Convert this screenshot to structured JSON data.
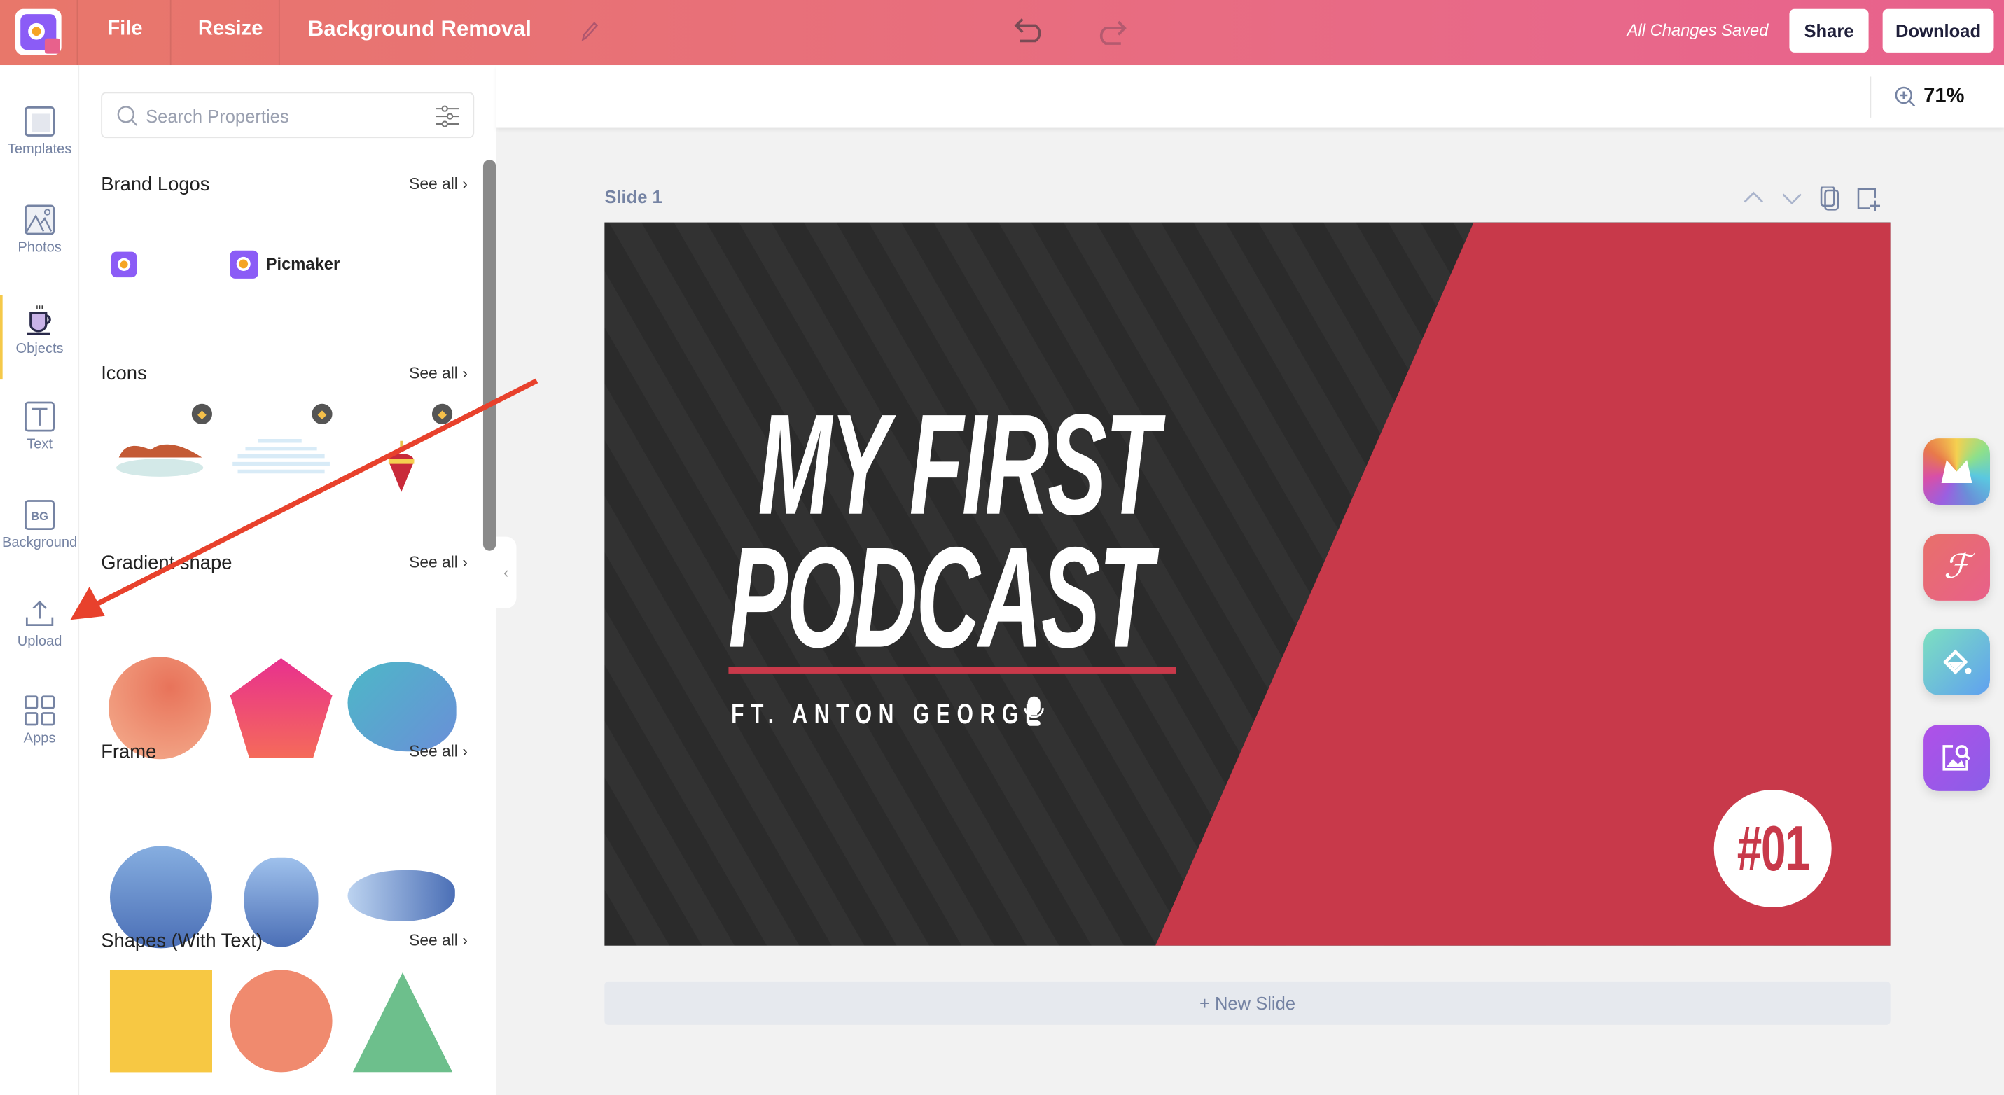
{
  "topbar": {
    "menu": [
      "File",
      "Resize",
      "Background Removal"
    ],
    "status": "All Changes Saved",
    "share_label": "Share",
    "download_label": "Download"
  },
  "rail": {
    "items": [
      {
        "label": "Templates",
        "icon": "templates-icon"
      },
      {
        "label": "Photos",
        "icon": "photos-icon"
      },
      {
        "label": "Objects",
        "icon": "objects-cup-icon",
        "active": true
      },
      {
        "label": "Text",
        "icon": "text-icon"
      },
      {
        "label": "Background",
        "icon": "bg-icon",
        "badge": "BG"
      },
      {
        "label": "Upload",
        "icon": "upload-icon"
      },
      {
        "label": "Apps",
        "icon": "apps-grid-icon"
      }
    ]
  },
  "panel": {
    "search_placeholder": "Search Properties",
    "see_all": "See all",
    "brand_logo_text": "Picmaker",
    "sections": [
      "Brand Logos",
      "Icons",
      "Gradient shape",
      "Frame",
      "Shapes (With Text)"
    ]
  },
  "zoom": "71%",
  "slide": {
    "label": "Slide 1",
    "title_line1": "MY FIRST",
    "title_line2": "PODCAST",
    "subtitle": "FT. ANTON GEORGE",
    "episode": "#01",
    "accent": "#c8394a",
    "dark": "#2d2d2d"
  },
  "new_slide": "+ New Slide",
  "colors": {
    "topbar_start": "#e8776a",
    "topbar_end": "#e8618c",
    "annotation_arrow": "#e8412c"
  }
}
